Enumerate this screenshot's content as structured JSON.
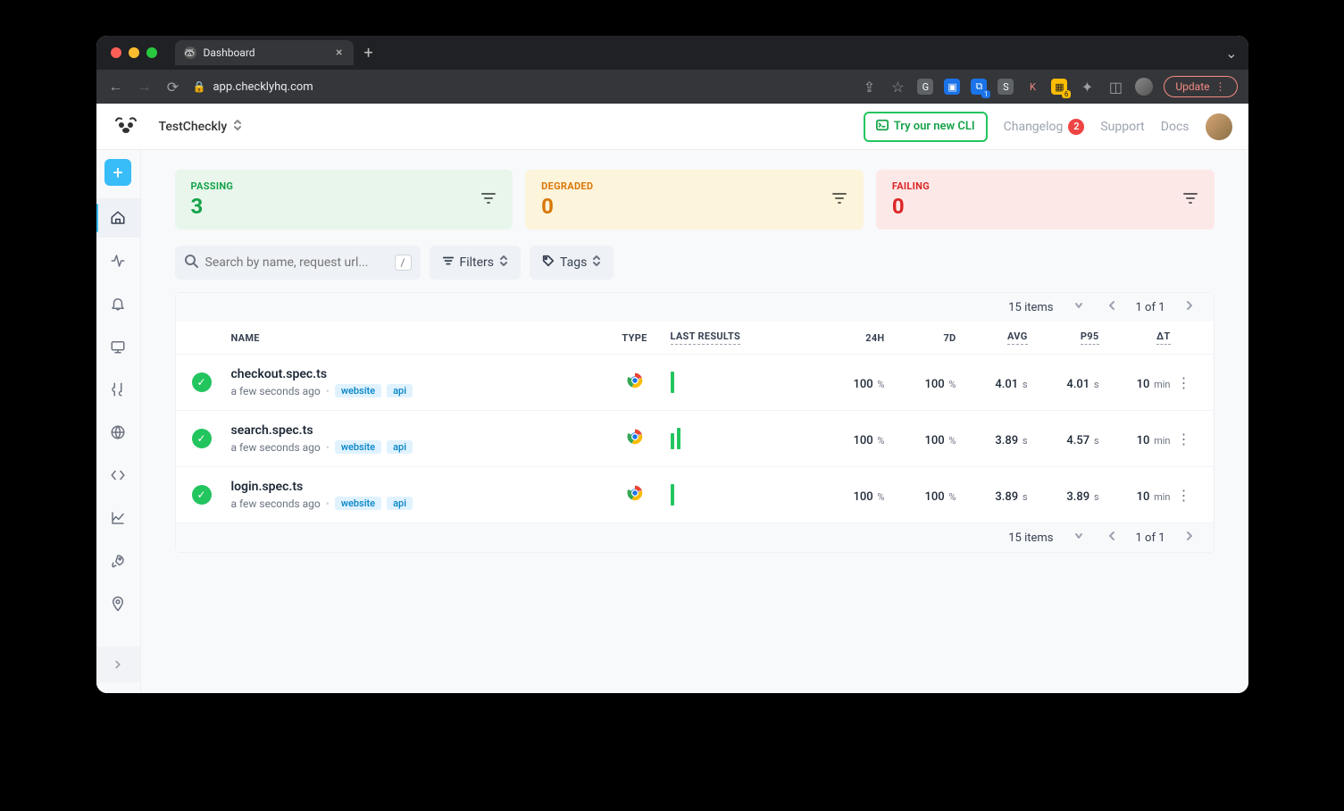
{
  "browser": {
    "tab_title": "Dashboard",
    "url": "app.checklyhq.com",
    "update_label": "Update"
  },
  "header": {
    "workspace": "TestCheckly",
    "cli_button": "Try our new CLI",
    "changelog": "Changelog",
    "changelog_badge": "2",
    "support": "Support",
    "docs": "Docs"
  },
  "summary": {
    "passing": {
      "label": "PASSING",
      "value": "3"
    },
    "degraded": {
      "label": "DEGRADED",
      "value": "0"
    },
    "failing": {
      "label": "FAILING",
      "value": "0"
    }
  },
  "filters": {
    "search_placeholder": "Search by name, request url...",
    "kbd": "/",
    "filters_label": "Filters",
    "tags_label": "Tags"
  },
  "table": {
    "items_label": "15 items",
    "page_label": "1 of 1",
    "headers": {
      "name": "NAME",
      "type": "TYPE",
      "last": "LAST RESULTS",
      "h24": "24H",
      "d7": "7D",
      "avg": "AVG",
      "p95": "P95",
      "dt": "ΔT"
    },
    "rows": [
      {
        "name": "checkout.spec.ts",
        "sub": "a few seconds ago",
        "tags": [
          "website",
          "api"
        ],
        "bars": [
          24
        ],
        "h24_v": "100",
        "h24_u": "%",
        "d7_v": "100",
        "d7_u": "%",
        "avg_v": "4.01",
        "avg_u": "s",
        "p95_v": "4.01",
        "p95_u": "s",
        "dt_v": "10",
        "dt_u": "min"
      },
      {
        "name": "search.spec.ts",
        "sub": "a few seconds ago",
        "tags": [
          "website",
          "api"
        ],
        "bars": [
          18,
          24
        ],
        "h24_v": "100",
        "h24_u": "%",
        "d7_v": "100",
        "d7_u": "%",
        "avg_v": "3.89",
        "avg_u": "s",
        "p95_v": "4.57",
        "p95_u": "s",
        "dt_v": "10",
        "dt_u": "min"
      },
      {
        "name": "login.spec.ts",
        "sub": "a few seconds ago",
        "tags": [
          "website",
          "api"
        ],
        "bars": [
          24
        ],
        "h24_v": "100",
        "h24_u": "%",
        "d7_v": "100",
        "d7_u": "%",
        "avg_v": "3.89",
        "avg_u": "s",
        "p95_v": "3.89",
        "p95_u": "s",
        "dt_v": "10",
        "dt_u": "min"
      }
    ]
  }
}
